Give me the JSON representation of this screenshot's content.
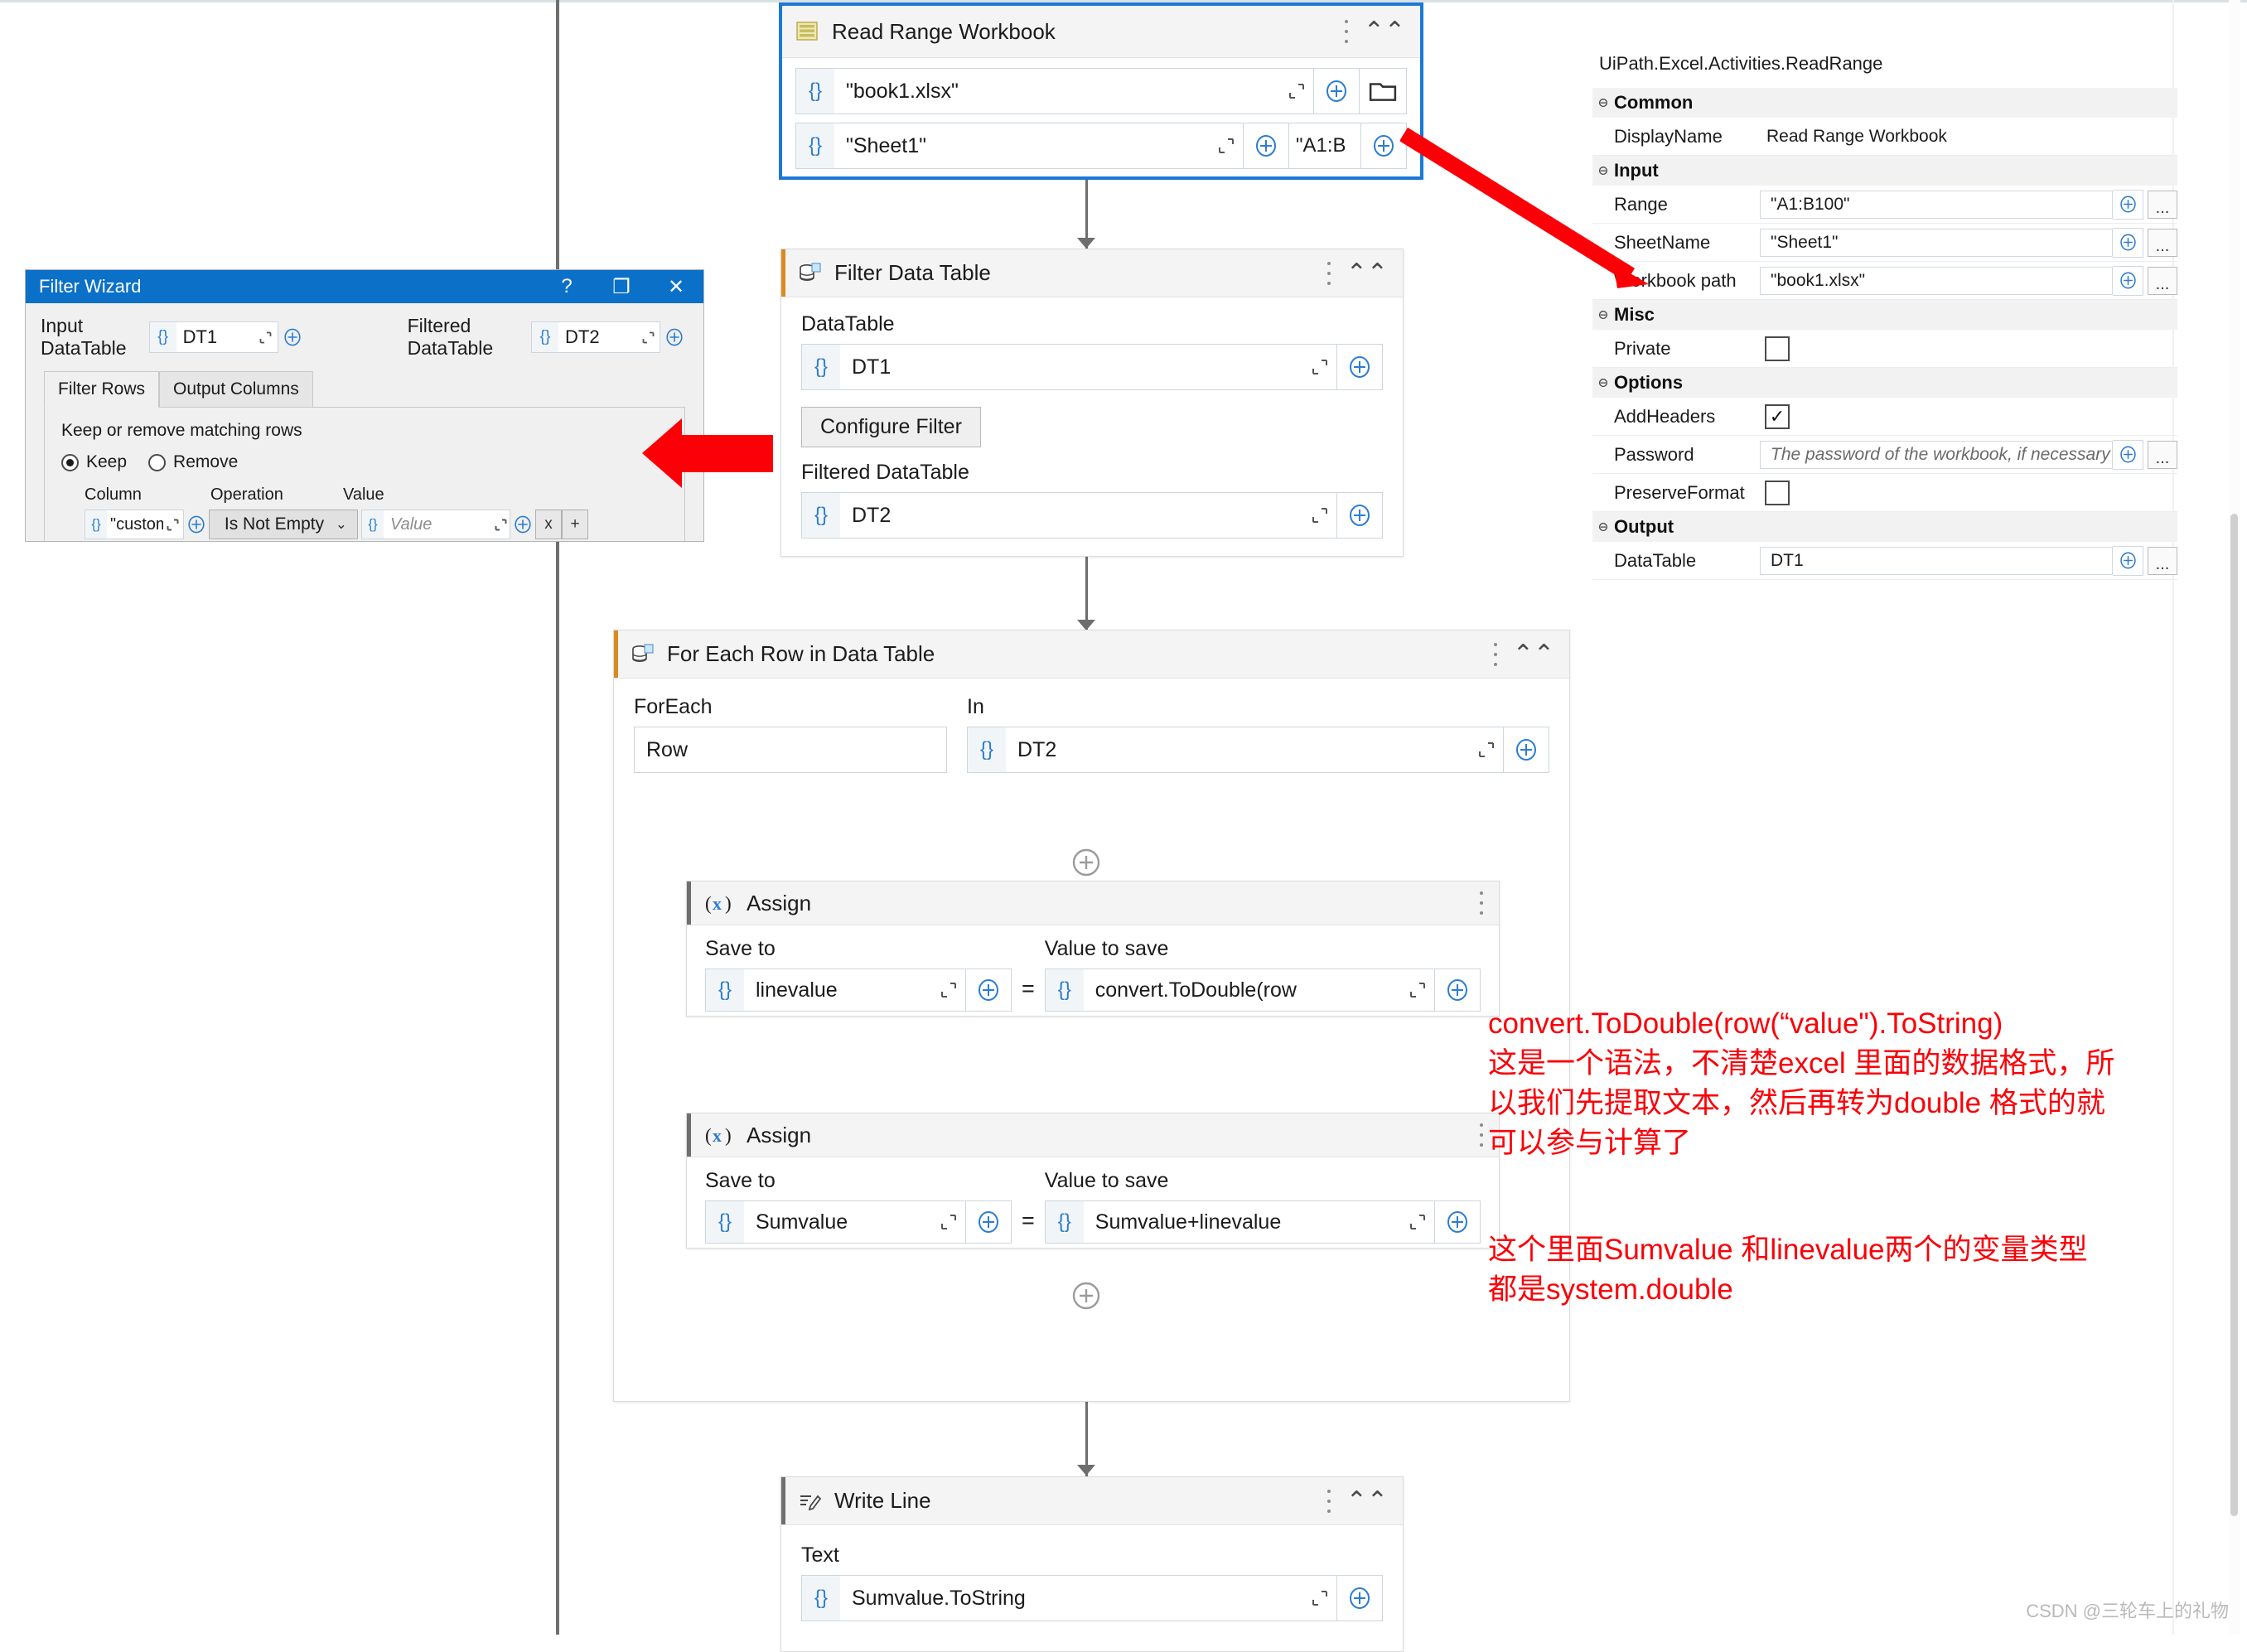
{
  "canvas": {
    "read_range": {
      "title": "Read Range Workbook",
      "icon": "excel-sheet-icon",
      "workbook_value": "\"book1.xlsx\"",
      "sheet_value": "\"Sheet1\"",
      "range_value": "\"A1:B",
      "curly": "{}"
    },
    "filter_data_table": {
      "title": "Filter Data Table",
      "icon": "data-table-icon",
      "datatable_label": "DataTable",
      "datatable_value": "DT1",
      "configure_button": "Configure Filter",
      "filtered_label": "Filtered DataTable",
      "filtered_value": "DT2"
    },
    "for_each_row": {
      "title": "For Each Row in Data Table",
      "icon": "data-table-icon",
      "foreach_label": "ForEach",
      "foreach_value": "Row",
      "in_label": "In",
      "in_value": "DT2"
    },
    "assign_1": {
      "title": "Assign",
      "icon": "assign-x-icon",
      "save_to_label": "Save to",
      "save_to_value": "linevalue",
      "equals": "=",
      "value_to_save_label": "Value to save",
      "value_to_save_value": "convert.ToDouble(row"
    },
    "assign_2": {
      "title": "Assign",
      "icon": "assign-x-icon",
      "save_to_label": "Save to",
      "save_to_value": "Sumvalue",
      "equals": "=",
      "value_to_save_label": "Value to save",
      "value_to_save_value": "Sumvalue+linevalue"
    },
    "write_line": {
      "title": "Write Line",
      "icon": "write-line-icon",
      "text_label": "Text",
      "text_value": "Sumvalue.ToString"
    }
  },
  "filter_wizard": {
    "title": "Filter Wizard",
    "titlebar_buttons": [
      "?",
      "❐",
      "✕"
    ],
    "input_datatable_label": "Input DataTable",
    "input_datatable_value": "DT1",
    "filtered_datatable_label": "Filtered DataTable",
    "filtered_datatable_value": "DT2",
    "tabs": [
      {
        "label": "Filter Rows",
        "active": true
      },
      {
        "label": "Output Columns",
        "active": false
      }
    ],
    "keep_remove_label": "Keep or remove matching rows",
    "keep_label": "Keep",
    "remove_label": "Remove",
    "keep_selected": true,
    "column_headers": [
      "Column",
      "Operation",
      "Value"
    ],
    "row": {
      "column_value": "\"custom",
      "operation_value": "Is Not Empty",
      "value_placeholder": "Value",
      "remove_btn": "x",
      "add_btn": "+"
    }
  },
  "properties": {
    "activity_type": "UiPath.Excel.Activities.ReadRange",
    "groups": [
      {
        "name": "Common",
        "rows": [
          {
            "name": "DisplayName",
            "kind": "text-plain",
            "value": "Read Range Workbook"
          }
        ]
      },
      {
        "name": "Input",
        "rows": [
          {
            "name": "Range",
            "kind": "expr",
            "value": "\"A1:B100\""
          },
          {
            "name": "SheetName",
            "kind": "expr",
            "value": "\"Sheet1\""
          },
          {
            "name": "Workbook path",
            "kind": "expr",
            "value": "\"book1.xlsx\""
          }
        ]
      },
      {
        "name": "Misc",
        "rows": [
          {
            "name": "Private",
            "kind": "checkbox",
            "checked": false
          }
        ]
      },
      {
        "name": "Options",
        "rows": [
          {
            "name": "AddHeaders",
            "kind": "checkbox",
            "checked": true
          },
          {
            "name": "Password",
            "kind": "expr-placeholder",
            "value": "The password of the workbook, if necessary"
          },
          {
            "name": "PreserveFormat",
            "kind": "checkbox",
            "checked": false
          }
        ]
      },
      {
        "name": "Output",
        "rows": [
          {
            "name": "DataTable",
            "kind": "expr",
            "value": "DT1"
          }
        ]
      }
    ]
  },
  "annotations": {
    "color": "#fb0007",
    "note1": "convert.ToDouble(row(“value\").ToString)\n这是一个语法，不清楚excel 里面的数据格式，所\n以我们先提取文本，然后再转为double 格式的就\n可以参与计算了",
    "note2": "这个里面Sumvalue 和linevalue两个的变量类型\n都是system.double"
  },
  "watermark": "CSDN @三轮车上的礼物"
}
